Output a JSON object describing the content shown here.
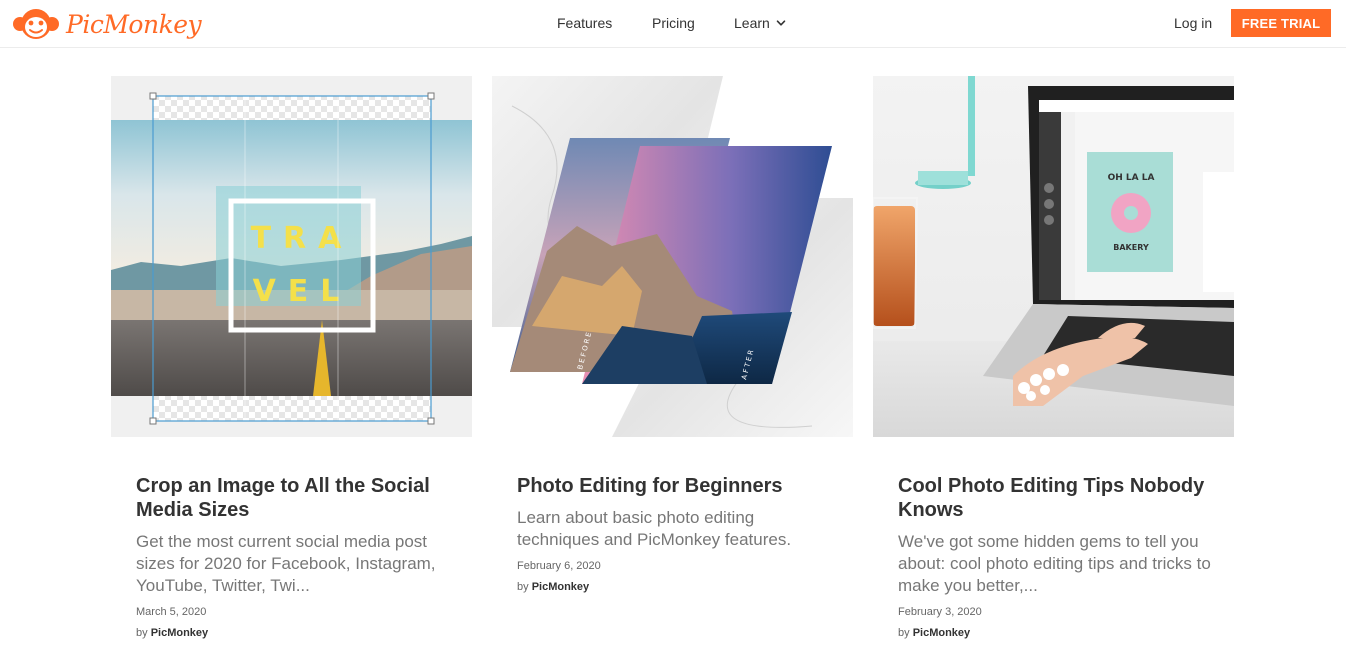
{
  "brand": {
    "name": "PicMonkey",
    "accent": "#ff6a26"
  },
  "nav": {
    "features": "Features",
    "pricing": "Pricing",
    "learn": "Learn",
    "login": "Log in",
    "trial": "FREE TRIAL"
  },
  "cards": [
    {
      "title": "Crop an Image to All the Social Media Sizes",
      "description": "Get the most current social media post sizes for 2020 for Facebook, Instagram, YouTube, Twitter, Twi...",
      "date": "March 5, 2020",
      "author_prefix": "by",
      "author": "PicMonkey",
      "image": {
        "word1": "TRA",
        "word2": "VEL"
      }
    },
    {
      "title": "Photo Editing for Beginners",
      "description": "Learn about basic photo editing techniques and PicMonkey features.",
      "date": "February 6, 2020",
      "author_prefix": "by",
      "author": "PicMonkey",
      "image": {
        "before": "BEFORE",
        "after": "AFTER"
      }
    },
    {
      "title": "Cool Photo Editing Tips Nobody Knows",
      "description": "We've got some hidden gems to tell you about: cool photo editing tips and tricks to make you better,...",
      "date": "February 3, 2020",
      "author_prefix": "by",
      "author": "PicMonkey",
      "image": {
        "line1": "OH LA LA",
        "line2": "BAKERY"
      }
    }
  ]
}
